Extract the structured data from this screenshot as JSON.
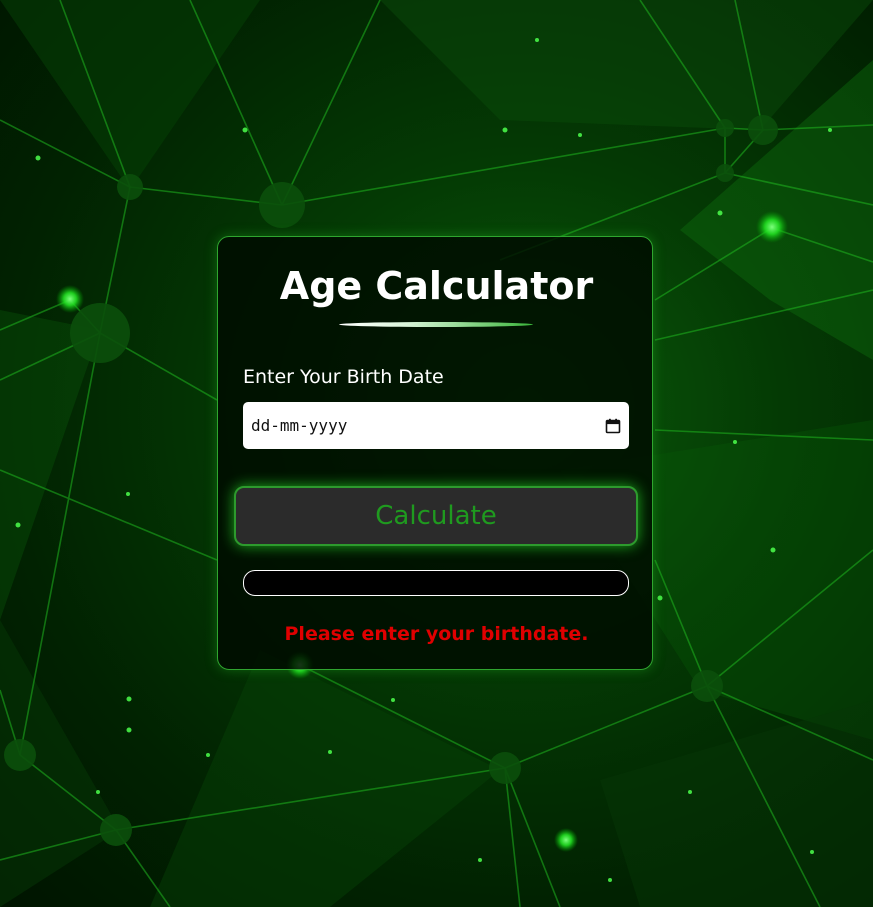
{
  "app": {
    "title": "Age Calculator"
  },
  "form": {
    "birth_date_label": "Enter Your Birth Date",
    "birth_date_placeholder": "dd-mm-yyyy",
    "birth_date_value": "",
    "calculate_label": "Calculate",
    "result_value": "",
    "error_message": "Please enter your birthdate."
  },
  "icons": {
    "date_picker": "calendar-icon"
  },
  "colors": {
    "accent_green": "#2d9a2d",
    "button_text": "#1f9a1f",
    "error_red": "#e00000",
    "card_background": "#000a00",
    "text_white": "#ffffff"
  }
}
